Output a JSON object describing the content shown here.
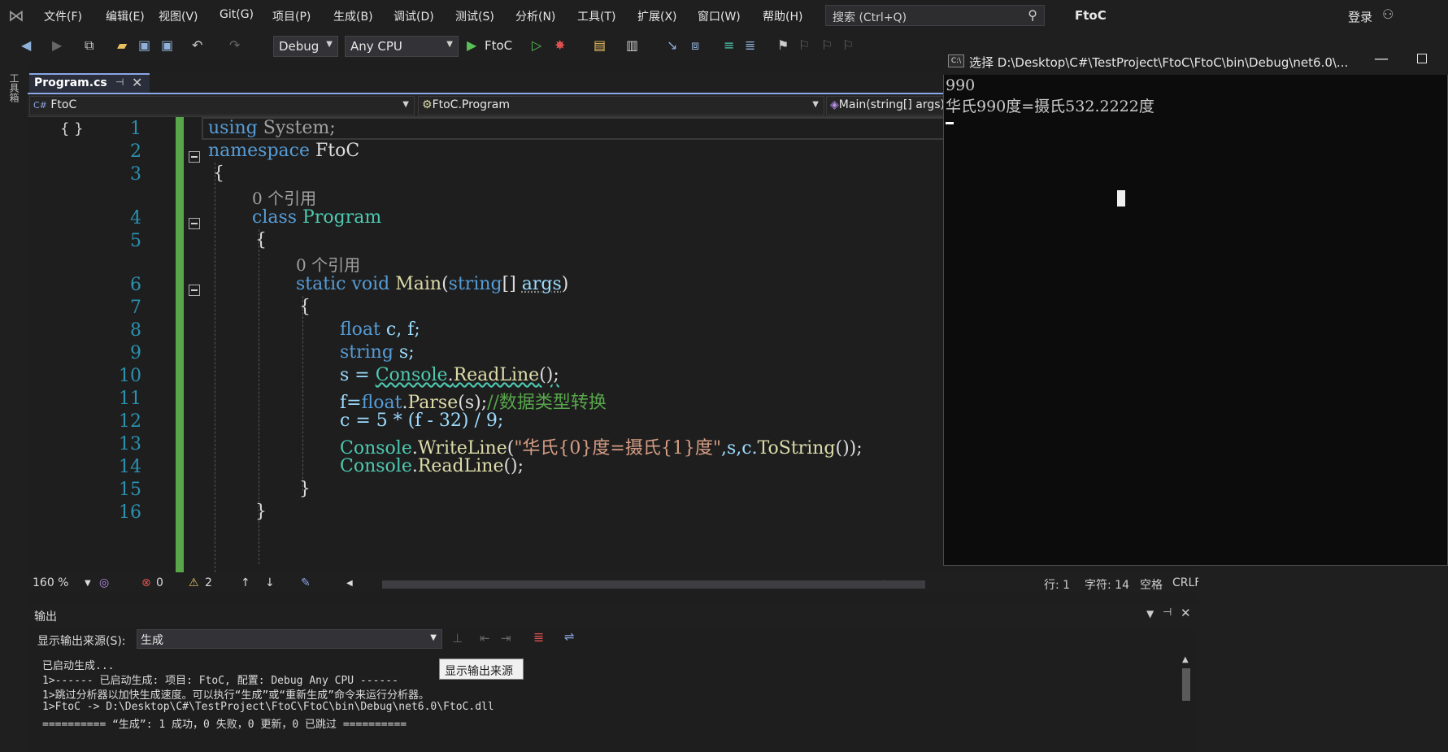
{
  "menubar": {
    "items": [
      "文件(F)",
      "编辑(E)",
      "视图(V)",
      "Git(G)",
      "项目(P)",
      "生成(B)",
      "调试(D)",
      "测试(S)",
      "分析(N)",
      "工具(T)",
      "扩展(X)",
      "窗口(W)",
      "帮助(H)"
    ],
    "search_placeholder": "搜索 (Ctrl+Q)",
    "app_title": "FtoC",
    "login": "登录"
  },
  "toolbar": {
    "config": "Debug",
    "platform": "Any CPU",
    "run_target": "FtoC"
  },
  "sidebar": {
    "toolbox_label": "工具箱"
  },
  "doc_tab": {
    "name": "Program.cs",
    "pin": "⊣",
    "close": "✕"
  },
  "navbar": {
    "project": "FtoC",
    "class": "FtoC.Program",
    "member": "Main(string[] args)"
  },
  "editor": {
    "line_numbers": [
      "1",
      "2",
      "3",
      "4",
      "5",
      "6",
      "7",
      "8",
      "9",
      "10",
      "11",
      "12",
      "13",
      "14",
      "15",
      "16"
    ],
    "refs_label_1": "0 个引用",
    "refs_label_2": "0 个引用",
    "code": {
      "l1_kw": "using",
      "l1_rest": " System;",
      "l2_kw": "namespace",
      "l2_rest": " FtoC",
      "l3": "{",
      "l4_kw": "class",
      "l4_ty": " Program",
      "l5": "{",
      "l6_kw": "static void",
      "l6_fn": " Main",
      "l6_p1": "(",
      "l6_kw2": "string",
      "l6_p2": "[] ",
      "l6_args": "args",
      "l6_p3": ")",
      "l7": "{",
      "l8_kw": "float",
      "l8_rest": " c, f;",
      "l9_kw": "string",
      "l9_rest": " s;",
      "l10_a": "s = ",
      "l10_ty": "Console",
      "l10_dot": ".",
      "l10_fn": "ReadLine",
      "l10_b": "();",
      "l11_a": "f=",
      "l11_kw": "float",
      "l11_dot": ".",
      "l11_fn": "Parse",
      "l11_b": "(s);",
      "l11_cm": "//数据类型转换",
      "l12": "c = 5 * (f - 32) / 9;",
      "l13_ty": "Console",
      "l13_dot": ".",
      "l13_fn": "WriteLine",
      "l13_p": "(",
      "l13_str": "\"华氏{0}度=摄氏{1}度\"",
      "l13_a": ",s,c.",
      "l13_fn2": "ToString",
      "l13_b": "());",
      "l14_ty": "Console",
      "l14_dot": ".",
      "l14_fn": "ReadLine",
      "l14_b": "();",
      "l15": "}",
      "l16": "}"
    }
  },
  "editor_status": {
    "zoom": "160 %",
    "errors": "0",
    "warnings": "2",
    "line": "行: 1",
    "col": "字符: 14",
    "ws": "空格",
    "eol": "CRLF"
  },
  "output": {
    "title": "输出",
    "source_label": "显示输出来源(S):",
    "source_value": "生成",
    "tooltip": "显示输出来源",
    "lines": [
      "已启动生成...",
      "1>------ 已启动生成: 项目: FtoC, 配置: Debug Any CPU ------",
      "1>跳过分析器以加快生成速度。可以执行“生成”或“重新生成”命令来运行分析器。",
      "1>FtoC -> D:\\Desktop\\C#\\TestProject\\FtoC\\FtoC\\bin\\Debug\\net6.0\\FtoC.dll",
      "========== “生成”: 1 成功，0 失败，0 更新，0 已跳过 =========="
    ]
  },
  "console": {
    "title": "选择 D:\\Desktop\\C#\\TestProject\\FtoC\\FtoC\\bin\\Debug\\net6.0\\...",
    "icon_text": "C:\\",
    "line1": "990",
    "line2": "华氏990度=摄氏532.2222度"
  }
}
